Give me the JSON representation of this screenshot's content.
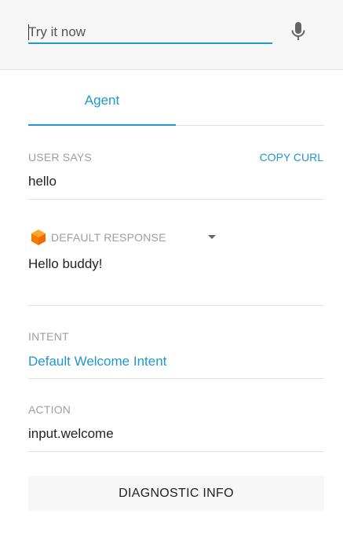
{
  "search": {
    "placeholder": "Try it now",
    "value": ""
  },
  "tabs": [
    {
      "label": "Agent",
      "active": true
    }
  ],
  "user_says": {
    "label": "USER SAYS",
    "copy_curl": "COPY CURL",
    "value": "hello"
  },
  "response": {
    "label": "DEFAULT RESPONSE",
    "value": "Hello buddy!"
  },
  "intent": {
    "label": "INTENT",
    "value": "Default Welcome Intent"
  },
  "action": {
    "label": "ACTION",
    "value": "input.welcome"
  },
  "diagnostic": {
    "label": "DIAGNOSTIC INFO"
  },
  "colors": {
    "accent": "#2196d3",
    "cube": "#f57c00"
  }
}
